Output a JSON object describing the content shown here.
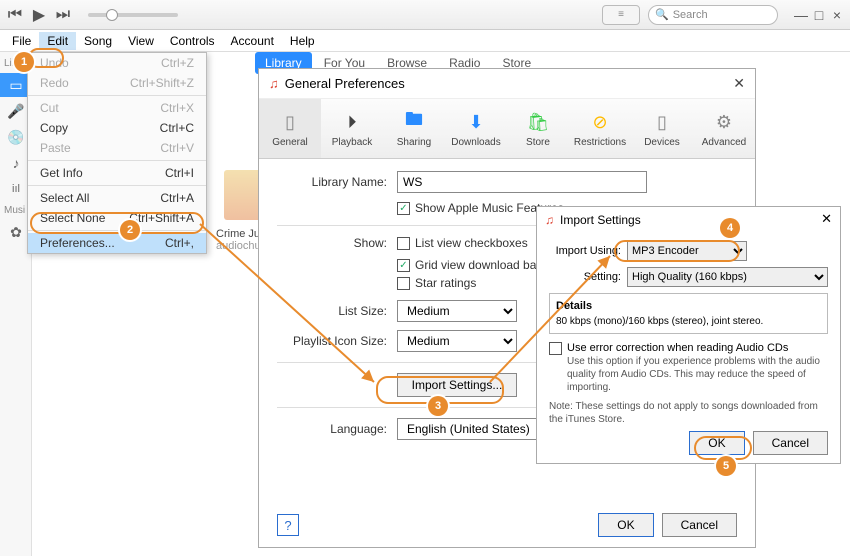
{
  "titlebar": {
    "search_placeholder": "Search"
  },
  "menubar": [
    "File",
    "Edit",
    "Song",
    "View",
    "Controls",
    "Account",
    "Help"
  ],
  "libtabs": [
    "Library",
    "For You",
    "Browse",
    "Radio",
    "Store"
  ],
  "sidebar": {
    "label_library": "Libra",
    "label_music": "Musi"
  },
  "edit_menu": {
    "undo": {
      "label": "Undo",
      "sc": "Ctrl+Z"
    },
    "redo": {
      "label": "Redo",
      "sc": "Ctrl+Shift+Z"
    },
    "cut": {
      "label": "Cut",
      "sc": "Ctrl+X"
    },
    "copy": {
      "label": "Copy",
      "sc": "Ctrl+C"
    },
    "paste": {
      "label": "Paste",
      "sc": "Ctrl+V"
    },
    "getinfo": {
      "label": "Get Info",
      "sc": "Ctrl+I"
    },
    "selectall": {
      "label": "Select All",
      "sc": "Ctrl+A"
    },
    "selectnone": {
      "label": "Select None",
      "sc": "Ctrl+Shift+A"
    },
    "preferences": {
      "label": "Preferences...",
      "sc": "Ctrl+,"
    }
  },
  "podcast": {
    "title": "Crime Junk",
    "author": "audiochuck"
  },
  "prefs": {
    "title": "General Preferences",
    "tabs": [
      "General",
      "Playback",
      "Sharing",
      "Downloads",
      "Store",
      "Restrictions",
      "Devices",
      "Advanced"
    ],
    "library_name_label": "Library Name:",
    "library_name": "WS",
    "show_apple": "Show Apple Music Features",
    "show_label": "Show:",
    "show_listview": "List view checkboxes",
    "show_grid": "Grid view download badges",
    "show_star": "Star ratings",
    "list_size_label": "List Size:",
    "list_size": "Medium",
    "playlist_icon_label": "Playlist Icon Size:",
    "playlist_icon": "Medium",
    "import_settings_btn": "Import Settings...",
    "language_label": "Language:",
    "language": "English (United States)",
    "help": "?",
    "ok": "OK",
    "cancel": "Cancel"
  },
  "import": {
    "title": "Import Settings",
    "using_label": "Import Using:",
    "using": "MP3 Encoder",
    "setting_label": "Setting:",
    "setting": "High Quality (160 kbps)",
    "details_label": "Details",
    "details_text": "80 kbps (mono)/160 kbps (stereo), joint stereo.",
    "error_corr": "Use error correction when reading Audio CDs",
    "error_hint": "Use this option if you experience problems with the audio quality from Audio CDs.  This may reduce the speed of importing.",
    "note": "Note: These settings do not apply to songs downloaded from the iTunes Store.",
    "ok": "OK",
    "cancel": "Cancel"
  },
  "badges": [
    "1",
    "2",
    "3",
    "4",
    "5"
  ]
}
